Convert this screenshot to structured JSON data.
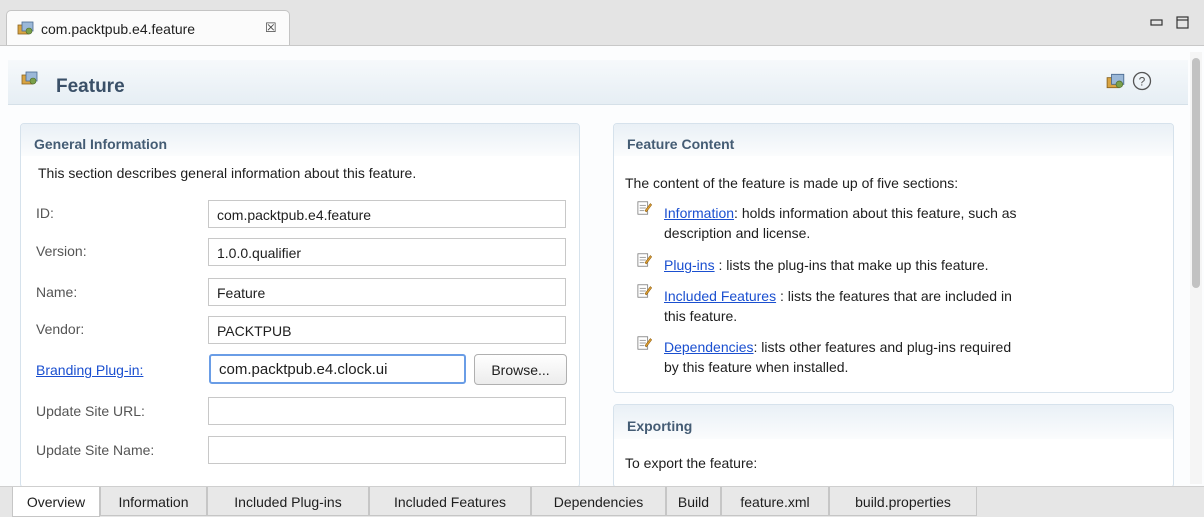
{
  "editor_tab": {
    "title": "com.packtpub.e4.feature",
    "close_glyph": "☒"
  },
  "header": {
    "title": "Feature"
  },
  "general": {
    "title": "General Information",
    "description": "This section describes general information about this feature.",
    "fields": [
      {
        "label": "ID:",
        "value": "com.packtpub.e4.feature"
      },
      {
        "label": "Version:",
        "value": "1.0.0.qualifier"
      },
      {
        "label": "Name:",
        "value": "Feature"
      },
      {
        "label": "Vendor:",
        "value": "PACKTPUB"
      },
      {
        "label": "Branding Plug-in:",
        "value": "com.packtpub.e4.clock.ui"
      },
      {
        "label": "Update Site URL:",
        "value": ""
      },
      {
        "label": "Update Site Name:",
        "value": ""
      }
    ],
    "browse_label": "Browse..."
  },
  "content": {
    "title": "Feature Content",
    "intro": "The content of the feature is made up of five sections:",
    "entries": [
      {
        "link": "Information",
        "line1": ": holds information about this feature, such as",
        "line2": "description and license."
      },
      {
        "link": "Plug-ins",
        "line1": " : lists the plug-ins that make up this feature.",
        "line2": ""
      },
      {
        "link": "Included Features",
        "line1": " : lists the features that are included in",
        "line2": "this feature."
      },
      {
        "link": "Dependencies",
        "line1": ": lists other features and plug-ins required",
        "line2": "by this feature when installed."
      }
    ]
  },
  "exporting": {
    "title": "Exporting",
    "text": "To export the feature:"
  },
  "bottom_tabs": [
    "Overview",
    "Information",
    "Included Plug-ins",
    "Included Features",
    "Dependencies",
    "Build",
    "feature.xml",
    "build.properties"
  ],
  "colors": {
    "link": "#1a4fd0",
    "section_title": "#445c74",
    "header_title": "#3a5068",
    "focus": "#6a9de6"
  }
}
